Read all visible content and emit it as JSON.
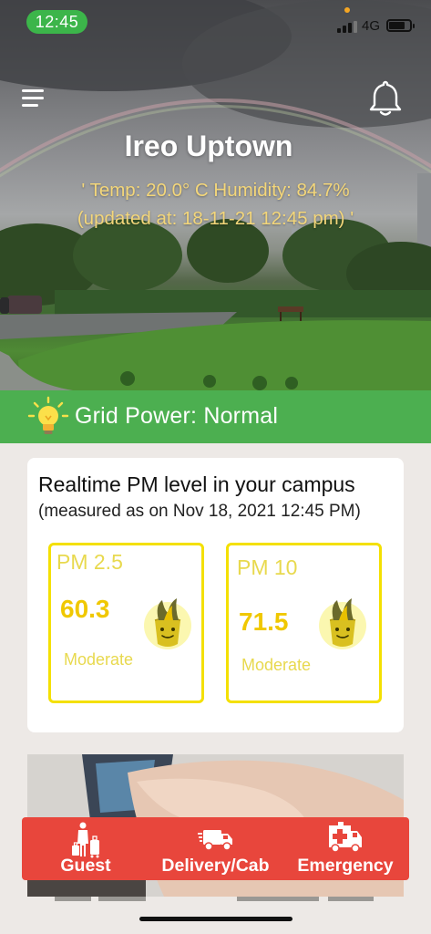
{
  "status_bar": {
    "time": "12:45",
    "network": "4G"
  },
  "header": {
    "place_name": "Ireo Uptown",
    "weather_line1": "' Temp: 20.0° C  Humidity: 84.7%",
    "weather_line2": "(updated at: 18-11-21 12:45 pm) '"
  },
  "grid": {
    "label": "Grid Power: Normal"
  },
  "pm": {
    "title": "Realtime PM level in your campus",
    "subtitle": "(measured as on Nov 18, 2021 12:45 PM)",
    "readings": [
      {
        "label": "PM 2.5",
        "value": "60.3",
        "status": "Moderate"
      },
      {
        "label": "PM 10",
        "value": "71.5",
        "status": "Moderate"
      }
    ]
  },
  "actions": [
    {
      "label": "Guest",
      "icon": "guest-luggage-icon"
    },
    {
      "label": "Delivery/Cab",
      "icon": "delivery-truck-icon"
    },
    {
      "label": "Emergency",
      "icon": "ambulance-icon"
    }
  ],
  "colors": {
    "status_pill": "#3cb54a",
    "grid_bar": "#4caf50",
    "pm_border": "#f4e000",
    "pm_value": "#f0c800",
    "action_bar": "#e8463c"
  }
}
